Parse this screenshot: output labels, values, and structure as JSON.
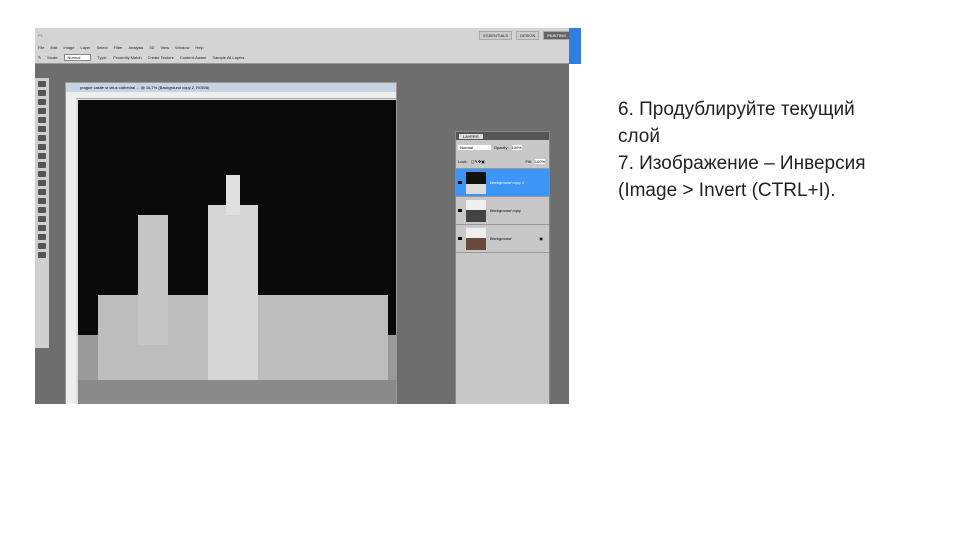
{
  "app": {
    "workspaces": [
      "ESSENTIALS",
      "DESIGN",
      "PAINTING"
    ],
    "active_workspace": "PAINTING",
    "menu": [
      "File",
      "Edit",
      "Image",
      "Layer",
      "Select",
      "Filter",
      "Analysis",
      "3D",
      "View",
      "Window",
      "Help"
    ],
    "options": {
      "mode_label": "Mode:",
      "mode_value": "Normal",
      "type_label": "Type:",
      "proximity": "Proximity Match",
      "create_texture": "Create Texture",
      "content_aware": "Content-Aware",
      "sample_all": "Sample All Layers"
    },
    "document_title": "prague castle st vitus cathedral ... @ 16,7% (Background copy 2, RGB/8)",
    "layers_panel": {
      "tab": "LAYERS",
      "blend": "Normal",
      "opacity_label": "Opacity:",
      "opacity": "100%",
      "lock_label": "Lock:",
      "fill_label": "Fill:",
      "fill": "100%",
      "layers": [
        {
          "name": "Background copy 2",
          "selected": true
        },
        {
          "name": "Background copy",
          "selected": false
        },
        {
          "name": "Background",
          "selected": false
        }
      ]
    }
  },
  "caption": {
    "line1": "6. Продублируйте текущий",
    "line2": "слой",
    "line3": "7. Изображение – Инверсия",
    "line4": "(Image > Invert (CTRL+I)."
  }
}
